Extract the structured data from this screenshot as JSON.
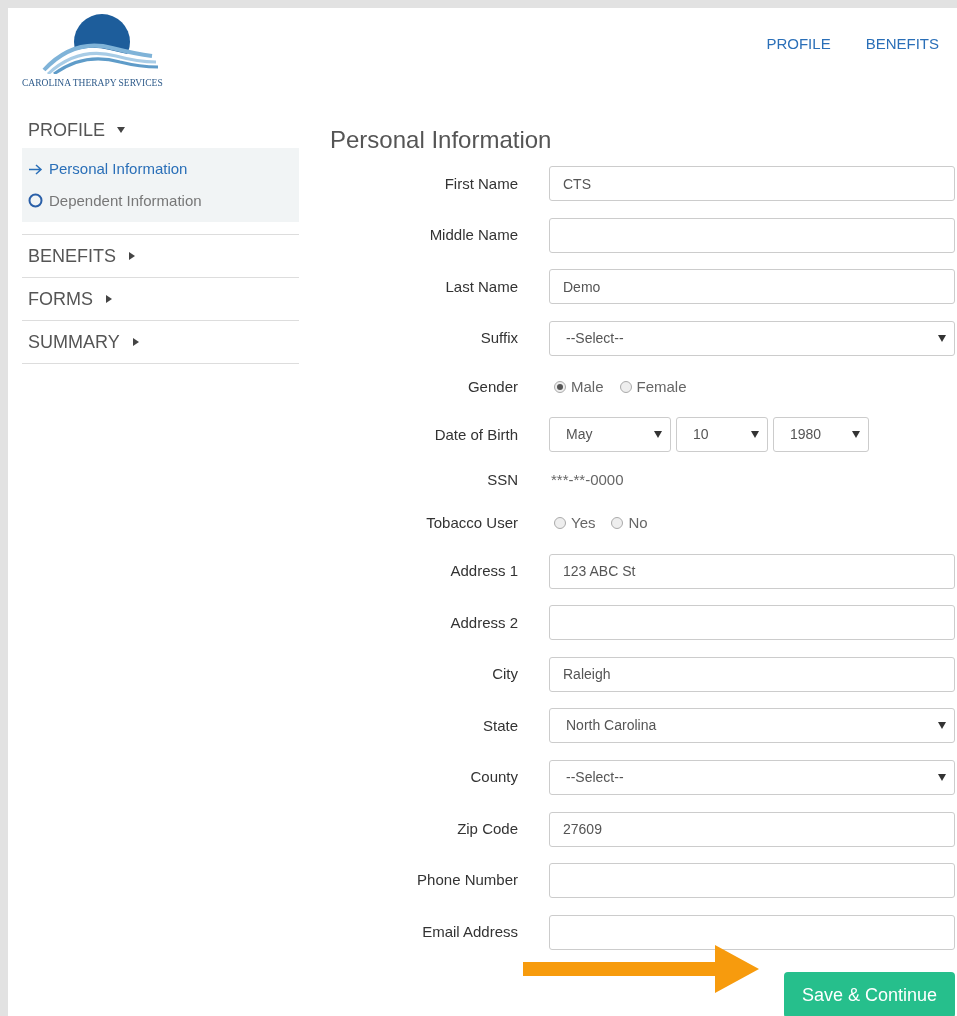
{
  "logo": {
    "text": "CAROLINA THERAPY SERVICES"
  },
  "top_nav": [
    {
      "label": "PROFILE"
    },
    {
      "label": "BENEFITS"
    }
  ],
  "sidebar": {
    "sections": [
      {
        "label": "PROFILE",
        "expanded": true,
        "children": [
          {
            "label": "Personal Information",
            "selected": true
          },
          {
            "label": "Dependent Information",
            "selected": false
          }
        ]
      },
      {
        "label": "BENEFITS",
        "expanded": false
      },
      {
        "label": "FORMS",
        "expanded": false
      },
      {
        "label": "SUMMARY",
        "expanded": false
      }
    ]
  },
  "form": {
    "title": "Personal Information",
    "fields": [
      {
        "kind": "text",
        "label": "First Name",
        "value": "CTS"
      },
      {
        "kind": "text",
        "label": "Middle Name"
      },
      {
        "kind": "text",
        "label": "Last Name",
        "value": "Demo"
      },
      {
        "kind": "select",
        "label": "Suffix",
        "value": "--Select--"
      },
      {
        "kind": "radio",
        "label": "Gender",
        "options": [
          {
            "label": "Male",
            "selected": true
          },
          {
            "label": "Female",
            "selected": false
          }
        ]
      },
      {
        "kind": "date",
        "label": "Date of Birth",
        "parts": [
          "May",
          "10",
          "1980"
        ]
      },
      {
        "kind": "static",
        "label": "SSN",
        "value": "***-**-0000"
      },
      {
        "kind": "radio",
        "label": "Tobacco User",
        "options": [
          {
            "label": "Yes",
            "selected": false
          },
          {
            "label": "No",
            "selected": false
          }
        ]
      },
      {
        "kind": "text",
        "label": "Address 1",
        "value": "123 ABC St"
      },
      {
        "kind": "text",
        "label": "Address 2"
      },
      {
        "kind": "text",
        "label": "City",
        "value": "Raleigh"
      },
      {
        "kind": "select",
        "label": "State",
        "value": "North Carolina"
      },
      {
        "kind": "select",
        "label": "County",
        "value": "--Select--"
      },
      {
        "kind": "text",
        "label": "Zip Code",
        "value": "27609"
      },
      {
        "kind": "text",
        "label": "Phone Number"
      },
      {
        "kind": "text",
        "label": "Email Address"
      }
    ],
    "submit": "Save & Continue"
  }
}
